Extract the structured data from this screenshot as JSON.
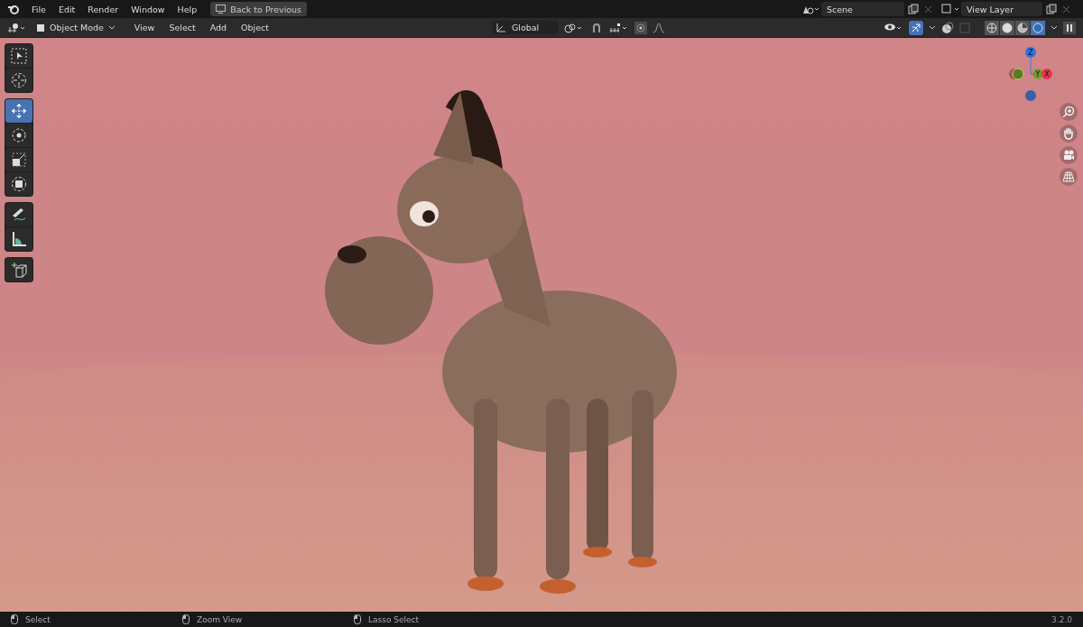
{
  "top_bar": {
    "menus": [
      "File",
      "Edit",
      "Render",
      "Window",
      "Help"
    ],
    "back_button": "Back to Previous",
    "scene": "Scene",
    "view_layer": "View Layer"
  },
  "header": {
    "mode": "Object Mode",
    "menus": [
      "View",
      "Select",
      "Add",
      "Object"
    ],
    "orientation": "Global",
    "snap_on": false,
    "gizmo_on": true,
    "shading_modes": [
      {
        "kind": "wireframe",
        "selected": false
      },
      {
        "kind": "solid",
        "selected": false
      },
      {
        "kind": "material",
        "selected": false
      },
      {
        "kind": "rendered",
        "selected": true
      }
    ]
  },
  "tool_groups": [
    [
      {
        "kind": "select_box",
        "selected": false
      },
      {
        "kind": "cursor",
        "selected": false
      }
    ],
    [
      {
        "kind": "move",
        "selected": true
      },
      {
        "kind": "rotate",
        "selected": false
      },
      {
        "kind": "scale",
        "selected": false
      },
      {
        "kind": "transform",
        "selected": false
      }
    ],
    [
      {
        "kind": "annotate",
        "selected": false
      },
      {
        "kind": "measure",
        "selected": false
      }
    ],
    [
      {
        "kind": "add_cube",
        "selected": false
      }
    ]
  ],
  "gizmo": {
    "z": "Z",
    "y": "Y",
    "x": "X"
  },
  "status_bar": {
    "items": [
      "Select",
      "Zoom View",
      "Lasso Select"
    ],
    "version": "3.2.0"
  }
}
